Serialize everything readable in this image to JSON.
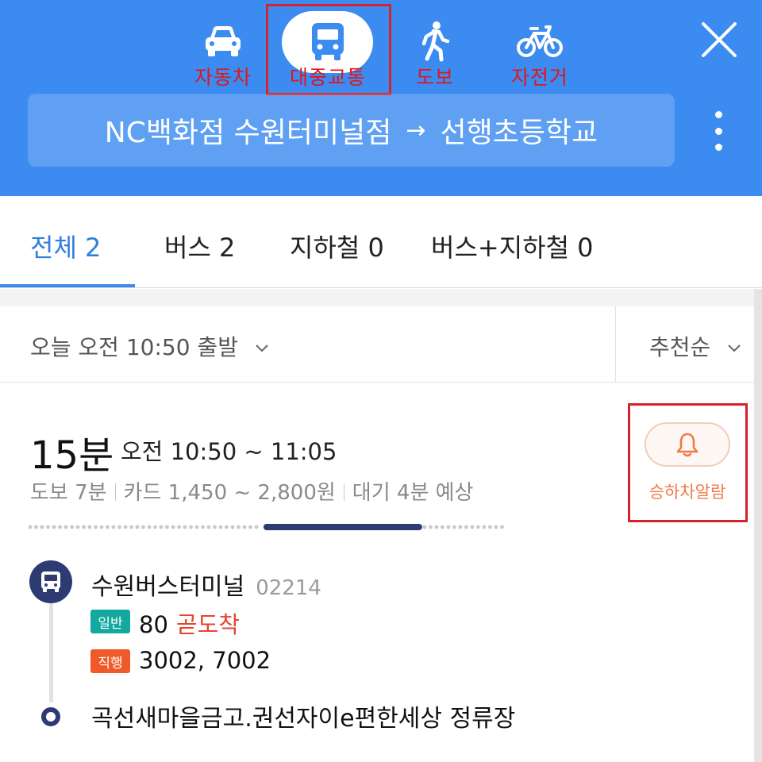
{
  "header": {
    "modes": [
      {
        "label": "자동차",
        "icon": "car-icon"
      },
      {
        "label": "대중교통",
        "icon": "bus-icon"
      },
      {
        "label": "도보",
        "icon": "walk-icon"
      },
      {
        "label": "자전거",
        "icon": "bicycle-icon"
      }
    ],
    "selected_mode": "대중교통",
    "close_icon": "close-icon",
    "more_icon": "more-vertical-icon",
    "route": {
      "origin": "NC백화점 수원터미널점",
      "arrow": "→",
      "destination": "선행초등학교"
    },
    "colors": {
      "background": "#3c8bf0",
      "highlight": "#d6222a"
    }
  },
  "tabs": [
    {
      "label": "전체 2",
      "active": true
    },
    {
      "label": "버스 2",
      "active": false
    },
    {
      "label": "지하철 0",
      "active": false
    },
    {
      "label": "버스+지하철 0",
      "active": false
    }
  ],
  "filter": {
    "departure": "오늘 오전 10:50 출발",
    "sort": "추천순"
  },
  "result": {
    "duration": "15분",
    "time_range": "오전 10:50 ~ 11:05",
    "walk": "도보 7분",
    "fare": "카드 1,450 ~ 2,800원",
    "wait": "대기 4분 예상",
    "alarm_label": "승하차알람",
    "alarm_icon": "bell-icon",
    "progress": {
      "walk_fraction": 0.49,
      "ride_fraction": 0.33,
      "walk_after_fraction": 0.18
    },
    "stops": {
      "start_name": "수원버스터미널",
      "start_id": "02214",
      "end_name": "곡선새마을금고.권선자이e편한세상 정류장"
    },
    "buses": [
      {
        "type": "일반",
        "numbers": "80",
        "arrival": "곧도착",
        "color": "#13a9a1"
      },
      {
        "type": "직행",
        "numbers": "3002, 7002",
        "arrival": "",
        "color": "#f05a2a"
      }
    ]
  }
}
